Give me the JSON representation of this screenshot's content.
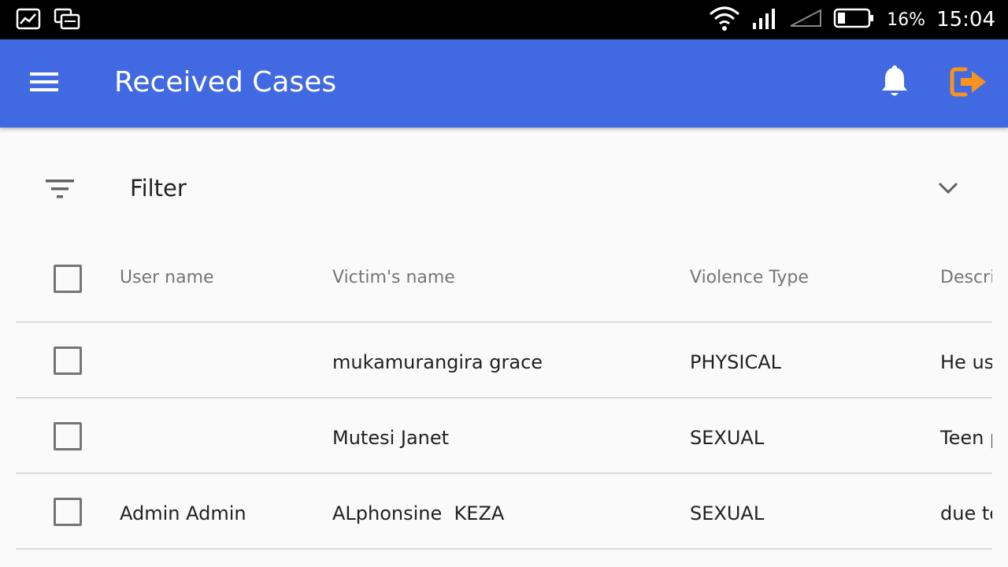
{
  "status_bar": {
    "battery_percent": "16%",
    "time": "15:04"
  },
  "app_bar": {
    "title": "Received Cases"
  },
  "filter": {
    "label": "Filter"
  },
  "table": {
    "headers": {
      "user_name": "User name",
      "victim_name": "Victim's name",
      "violence_type": "Violence Type",
      "description": "Descri"
    },
    "rows": [
      {
        "user_name": "",
        "victim_name": "mukamurangira grace",
        "violence_type": "PHYSICAL",
        "description": "He us"
      },
      {
        "user_name": "",
        "victim_name": "Mutesi Janet",
        "violence_type": "SEXUAL",
        "description": "Teen p"
      },
      {
        "user_name": "Admin Admin",
        "victim_name": "ALphonsine  KEZA",
        "violence_type": "SEXUAL",
        "description": "due to"
      }
    ]
  },
  "colors": {
    "app_bar": "#4169e1",
    "logout_icon": "#f7931e"
  }
}
